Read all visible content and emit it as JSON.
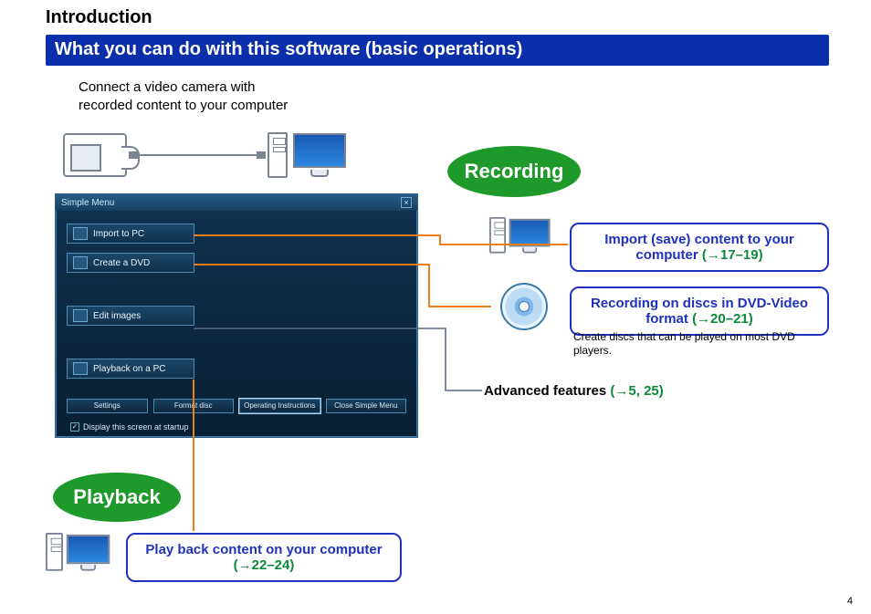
{
  "page_title": "Introduction",
  "section_title": "What you can do with this software (basic operations)",
  "connect_text_l1": "Connect a video camera with",
  "connect_text_l2": "recorded content to your computer",
  "page_number": "4",
  "ellipses": {
    "recording": "Recording",
    "playback": "Playback"
  },
  "callouts": {
    "import_text": "Import (save) content to your computer ",
    "import_ref": "(→17–19)",
    "dvd_text": "Recording on discs in DVD-Video format ",
    "dvd_ref": "(→20–21)",
    "dvd_note": "Create discs that can be played on most DVD players.",
    "play_text": "Play back content on your computer ",
    "play_ref": "(→22–24)"
  },
  "advanced_features_text": "Advanced features ",
  "advanced_features_ref": "(→5, 25)",
  "simple_menu": {
    "title": "Simple Menu",
    "items": {
      "import": "Import to PC",
      "create_dvd": "Create a DVD",
      "edit_images": "Edit images",
      "playback": "Playback on a PC"
    },
    "buttons": {
      "settings": "Settings",
      "format": "Format disc",
      "instructions": "Operating Instructions",
      "close": "Close Simple Menu"
    },
    "checkbox_label": "Display this screen at startup",
    "close_x": "×",
    "check_mark": "✓"
  }
}
